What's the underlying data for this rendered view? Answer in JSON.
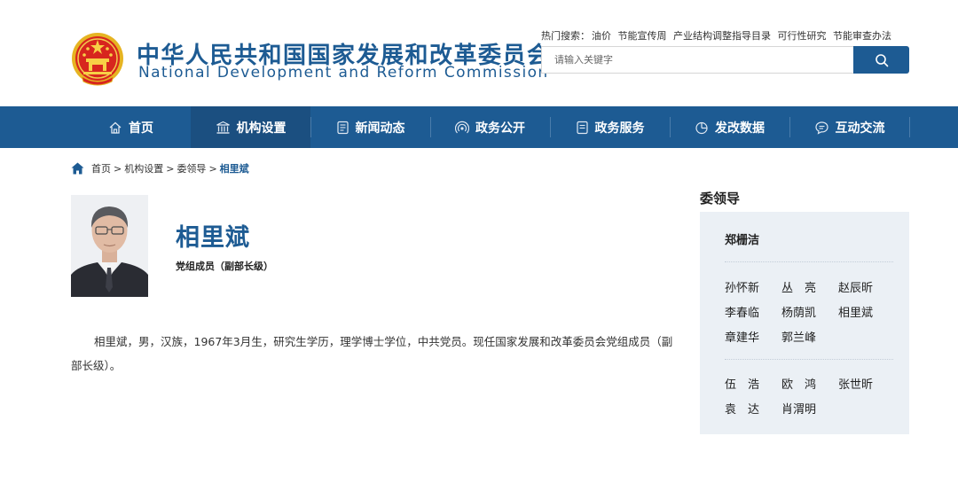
{
  "header": {
    "title_cn": "中华人民共和国国家发展和改革委员会",
    "title_en": "National Development and Reform Commission",
    "hot_label": "热门搜索：",
    "hot_links": [
      "油价",
      "节能宣传周",
      "产业结构调整指导目录",
      "可行性研究",
      "节能审查办法"
    ],
    "search_placeholder": "请输入关键字"
  },
  "nav": {
    "items": [
      {
        "label": "首页",
        "icon": "home-icon"
      },
      {
        "label": "机构设置",
        "icon": "institution-icon"
      },
      {
        "label": "新闻动态",
        "icon": "news-icon"
      },
      {
        "label": "政务公开",
        "icon": "broadcast-icon"
      },
      {
        "label": "政务服务",
        "icon": "service-icon"
      },
      {
        "label": "发改数据",
        "icon": "pie-chart-icon"
      },
      {
        "label": "互动交流",
        "icon": "chat-icon"
      }
    ],
    "active_index": 1
  },
  "breadcrumb": {
    "items": [
      "首页",
      "机构设置",
      "委领导"
    ],
    "current": "相里斌",
    "separator": ">"
  },
  "profile": {
    "name": "相里斌",
    "title": "党组成员（副部长级）",
    "bio": "相里斌，男，汉族，1967年3月生，研究生学历，理学博士学位，中共党员。现任国家发展和改革委员会党组成员（副部长级）。"
  },
  "sidebar": {
    "heading": "委领导",
    "top_leader": "郑栅洁",
    "group1": [
      "孙怀新",
      "丛　亮",
      "赵辰昕",
      "李春临",
      "杨荫凯",
      "相里斌",
      "章建华",
      "郭兰峰"
    ],
    "group2": [
      "伍　浩",
      "欧　鸿",
      "张世昕",
      "袁　达",
      "肖渭明"
    ]
  },
  "colors": {
    "brand_blue": "#1d5b93",
    "nav_active": "#1b4f80",
    "panel_bg": "#ebf0f5"
  }
}
